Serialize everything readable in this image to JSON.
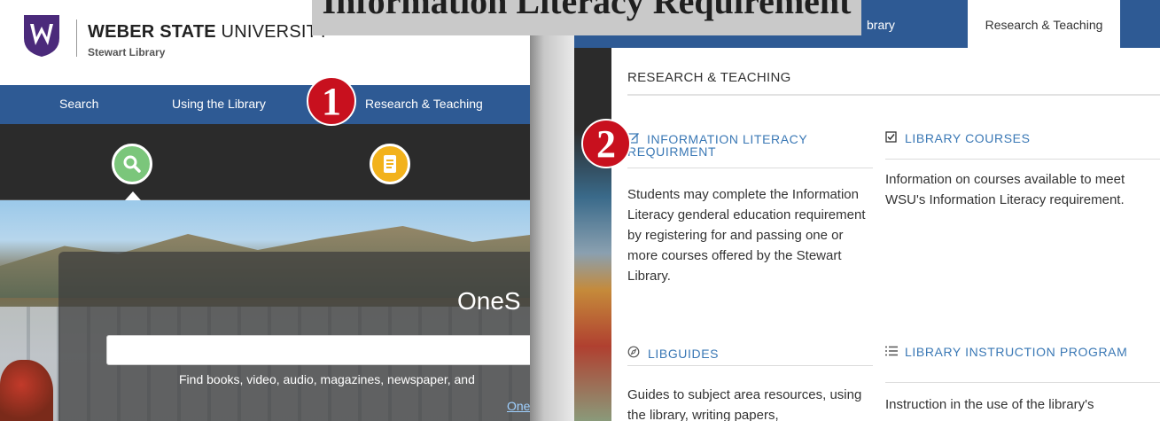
{
  "banner": {
    "title": "Information Literacy Requirement"
  },
  "left": {
    "header": {
      "brand_bold": "WEBER STATE",
      "brand_light": " UNIVERSITY",
      "subtitle": "Stewart Library"
    },
    "nav": [
      {
        "label": "Search"
      },
      {
        "label": "Using the Library"
      },
      {
        "label": "Research & Teaching"
      }
    ],
    "icons": [
      {
        "name": "search-icon"
      },
      {
        "name": "book-icon"
      }
    ],
    "search": {
      "title": "OneS",
      "placeholder": "",
      "help": "Find books, video, audio, magazines, newspaper, and",
      "link": "One"
    }
  },
  "callouts": {
    "one": "1",
    "two": "2"
  },
  "right": {
    "nav": {
      "partial": "brary",
      "active_tab": "Research & Teaching"
    },
    "dropdown": {
      "heading": "RESEARCH & TEACHING",
      "cards": [
        {
          "icon": "edit-icon",
          "title": "INFORMATION LITERACY REQUIRMENT",
          "body": "Students may complete the Information Literacy genderal education requirement by registering for and passing one or more courses offered by the Stewart Library."
        },
        {
          "icon": "checkbox-icon",
          "title": "LIBRARY COURSES",
          "body": "Information on courses available to meet WSU's Information Literacy requirement."
        },
        {
          "icon": "compass-icon",
          "title": "LIBGUIDES",
          "body": "Guides to subject area resources, using the library, writing papers,"
        },
        {
          "icon": "list-icon",
          "title": "LIBRARY INSTRUCTION PROGRAM",
          "body": "Instruction in the use of the library's"
        }
      ]
    }
  },
  "colors": {
    "nav_blue": "#2e5a94",
    "link_blue": "#3a78b5",
    "callout_red": "#c8101e",
    "wsu_purple": "#4b2a7b"
  }
}
